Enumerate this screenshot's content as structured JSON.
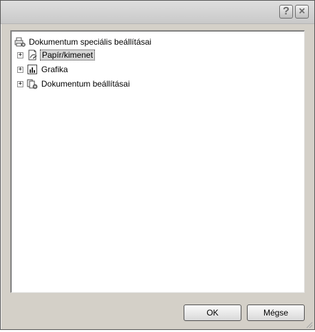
{
  "titlebar": {
    "help_label": "?",
    "close_label": "×"
  },
  "tree": {
    "root": {
      "label": "Dokumentum speciális beállításai",
      "icon": "printer-settings-icon"
    },
    "items": [
      {
        "label": "Papír/kimenet",
        "icon": "paper-output-icon",
        "expander": "+",
        "selected": true
      },
      {
        "label": "Grafika",
        "icon": "graphics-chart-icon",
        "expander": "+",
        "selected": false
      },
      {
        "label": "Dokumentum beállításai",
        "icon": "document-options-icon",
        "expander": "+",
        "selected": false
      }
    ]
  },
  "buttons": {
    "ok_label": "OK",
    "cancel_label": "Mégse"
  }
}
